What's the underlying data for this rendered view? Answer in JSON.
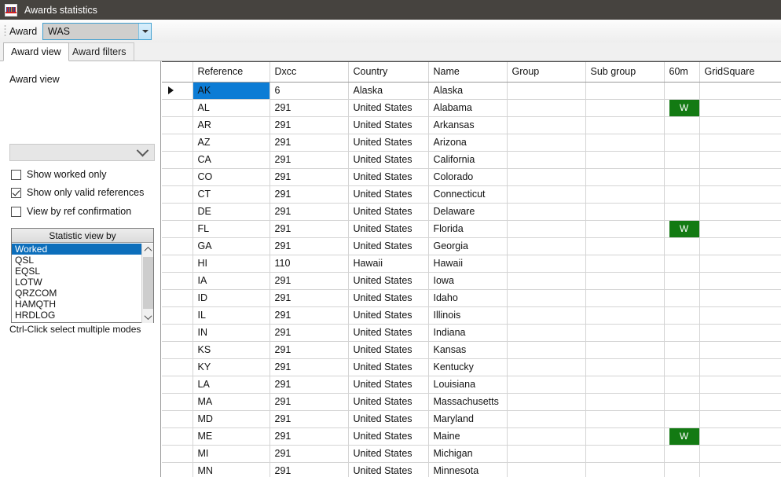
{
  "window": {
    "title": "Awards statistics",
    "icon": "app-logo-icon"
  },
  "toolbar": {
    "award_label": "Award",
    "award_value": "WAS",
    "award_dropdown_icon": "chevron-down-icon"
  },
  "tabs": [
    {
      "label": "Award view",
      "active": true
    },
    {
      "label": "Award filters",
      "active": false
    }
  ],
  "left_panel": {
    "section_title": "Award view",
    "view_select_value": "",
    "view_select_icon": "chevron-down-icon",
    "checkboxes": [
      {
        "label": "Show worked only",
        "checked": false
      },
      {
        "label": "Show only valid references",
        "checked": true
      },
      {
        "label": "View by ref confirmation",
        "checked": false
      }
    ],
    "statistic": {
      "header": "Statistic view by",
      "items": [
        {
          "label": "Worked",
          "selected": true
        },
        {
          "label": "QSL",
          "selected": false
        },
        {
          "label": "EQSL",
          "selected": false
        },
        {
          "label": "LOTW",
          "selected": false
        },
        {
          "label": "QRZCOM",
          "selected": false
        },
        {
          "label": "HAMQTH",
          "selected": false
        },
        {
          "label": "HRDLOG",
          "selected": false
        }
      ],
      "scroll_up_icon": "chevron-up-icon",
      "scroll_down_icon": "chevron-down-icon",
      "hint": "Ctrl-Click select multiple modes"
    }
  },
  "grid": {
    "columns": [
      "",
      "Reference",
      "Dxcc",
      "Country",
      "Name",
      "Group",
      "Sub group",
      "60m",
      "GridSquare"
    ],
    "worked_badge": "W",
    "rows": [
      {
        "current": true,
        "selected": true,
        "reference": "AK",
        "dxcc": "6",
        "country": "Alaska",
        "name": "Alaska",
        "group": "",
        "subgroup": "",
        "m60": "",
        "gridsquare": ""
      },
      {
        "current": false,
        "selected": false,
        "reference": "AL",
        "dxcc": "291",
        "country": "United States",
        "name": "Alabama",
        "group": "",
        "subgroup": "",
        "m60": "W",
        "gridsquare": ""
      },
      {
        "current": false,
        "selected": false,
        "reference": "AR",
        "dxcc": "291",
        "country": "United States",
        "name": "Arkansas",
        "group": "",
        "subgroup": "",
        "m60": "",
        "gridsquare": ""
      },
      {
        "current": false,
        "selected": false,
        "reference": "AZ",
        "dxcc": "291",
        "country": "United States",
        "name": "Arizona",
        "group": "",
        "subgroup": "",
        "m60": "",
        "gridsquare": ""
      },
      {
        "current": false,
        "selected": false,
        "reference": "CA",
        "dxcc": "291",
        "country": "United States",
        "name": "California",
        "group": "",
        "subgroup": "",
        "m60": "",
        "gridsquare": ""
      },
      {
        "current": false,
        "selected": false,
        "reference": "CO",
        "dxcc": "291",
        "country": "United States",
        "name": "Colorado",
        "group": "",
        "subgroup": "",
        "m60": "",
        "gridsquare": ""
      },
      {
        "current": false,
        "selected": false,
        "reference": "CT",
        "dxcc": "291",
        "country": "United States",
        "name": "Connecticut",
        "group": "",
        "subgroup": "",
        "m60": "",
        "gridsquare": ""
      },
      {
        "current": false,
        "selected": false,
        "reference": "DE",
        "dxcc": "291",
        "country": "United States",
        "name": "Delaware",
        "group": "",
        "subgroup": "",
        "m60": "",
        "gridsquare": ""
      },
      {
        "current": false,
        "selected": false,
        "reference": "FL",
        "dxcc": "291",
        "country": "United States",
        "name": "Florida",
        "group": "",
        "subgroup": "",
        "m60": "W",
        "gridsquare": ""
      },
      {
        "current": false,
        "selected": false,
        "reference": "GA",
        "dxcc": "291",
        "country": "United States",
        "name": "Georgia",
        "group": "",
        "subgroup": "",
        "m60": "",
        "gridsquare": ""
      },
      {
        "current": false,
        "selected": false,
        "reference": "HI",
        "dxcc": "110",
        "country": "Hawaii",
        "name": "Hawaii",
        "group": "",
        "subgroup": "",
        "m60": "",
        "gridsquare": ""
      },
      {
        "current": false,
        "selected": false,
        "reference": "IA",
        "dxcc": "291",
        "country": "United States",
        "name": "Iowa",
        "group": "",
        "subgroup": "",
        "m60": "",
        "gridsquare": ""
      },
      {
        "current": false,
        "selected": false,
        "reference": "ID",
        "dxcc": "291",
        "country": "United States",
        "name": "Idaho",
        "group": "",
        "subgroup": "",
        "m60": "",
        "gridsquare": ""
      },
      {
        "current": false,
        "selected": false,
        "reference": "IL",
        "dxcc": "291",
        "country": "United States",
        "name": "Illinois",
        "group": "",
        "subgroup": "",
        "m60": "",
        "gridsquare": ""
      },
      {
        "current": false,
        "selected": false,
        "reference": "IN",
        "dxcc": "291",
        "country": "United States",
        "name": "Indiana",
        "group": "",
        "subgroup": "",
        "m60": "",
        "gridsquare": ""
      },
      {
        "current": false,
        "selected": false,
        "reference": "KS",
        "dxcc": "291",
        "country": "United States",
        "name": "Kansas",
        "group": "",
        "subgroup": "",
        "m60": "",
        "gridsquare": ""
      },
      {
        "current": false,
        "selected": false,
        "reference": "KY",
        "dxcc": "291",
        "country": "United States",
        "name": "Kentucky",
        "group": "",
        "subgroup": "",
        "m60": "",
        "gridsquare": ""
      },
      {
        "current": false,
        "selected": false,
        "reference": "LA",
        "dxcc": "291",
        "country": "United States",
        "name": "Louisiana",
        "group": "",
        "subgroup": "",
        "m60": "",
        "gridsquare": ""
      },
      {
        "current": false,
        "selected": false,
        "reference": "MA",
        "dxcc": "291",
        "country": "United States",
        "name": "Massachusetts",
        "group": "",
        "subgroup": "",
        "m60": "",
        "gridsquare": ""
      },
      {
        "current": false,
        "selected": false,
        "reference": "MD",
        "dxcc": "291",
        "country": "United States",
        "name": "Maryland",
        "group": "",
        "subgroup": "",
        "m60": "",
        "gridsquare": ""
      },
      {
        "current": false,
        "selected": false,
        "reference": "ME",
        "dxcc": "291",
        "country": "United States",
        "name": "Maine",
        "group": "",
        "subgroup": "",
        "m60": "W",
        "gridsquare": ""
      },
      {
        "current": false,
        "selected": false,
        "reference": "MI",
        "dxcc": "291",
        "country": "United States",
        "name": "Michigan",
        "group": "",
        "subgroup": "",
        "m60": "",
        "gridsquare": ""
      },
      {
        "current": false,
        "selected": false,
        "reference": "MN",
        "dxcc": "291",
        "country": "United States",
        "name": "Minnesota",
        "group": "",
        "subgroup": "",
        "m60": "",
        "gridsquare": ""
      }
    ]
  },
  "colors": {
    "titlebar": "#46433f",
    "selection": "#0c7cd5",
    "worked_green": "#137a13",
    "list_selection": "#0c6ebb"
  }
}
